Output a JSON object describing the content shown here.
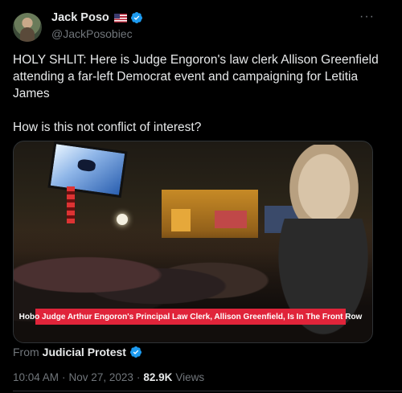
{
  "author": {
    "display_name": "Jack Poso",
    "handle": "@JackPosobiec",
    "flag_icon": "us-flag-icon",
    "verified_icon": "verified-badge-icon"
  },
  "more_label": "···",
  "tweet": {
    "line1": "HOLY SHLIT: Here is Judge Engoron's law clerk Allison Greenfield attending a far-left Democrat event and campaigning for Letitia James",
    "line2": "How is this not conflict of interest?"
  },
  "media": {
    "caption": "Hobo Judge Arthur Engoron's Principal Law Clerk, Allison Greenfield, Is In The Front Row"
  },
  "source": {
    "prefix": "From",
    "name": "Judicial Protest"
  },
  "meta": {
    "time": "10:04 AM",
    "sep1": "·",
    "date": "Nov 27, 2023",
    "sep2": "·",
    "views_count": "82.9K",
    "views_label": "Views"
  },
  "colors": {
    "background": "#000000",
    "text": "#e7e9ea",
    "muted": "#71767b",
    "verified": "#1d9bf0",
    "caption_bg": "#e0243a"
  }
}
